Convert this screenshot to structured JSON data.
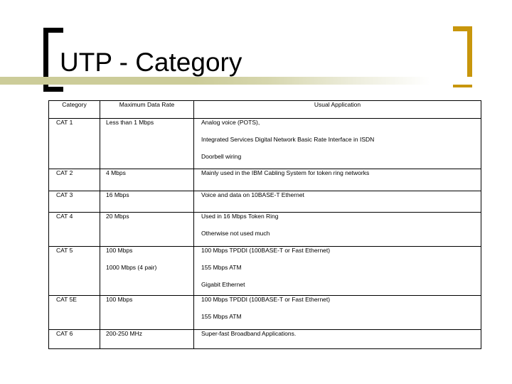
{
  "slide": {
    "title": "UTP - Category",
    "decor": {
      "bracket_left_color": "#000000",
      "bracket_right_color": "#C8960C",
      "band_color": "#CCCC99"
    }
  },
  "table": {
    "headers": [
      "Category",
      "Maximum Data Rate",
      "Usual Application"
    ],
    "rows": [
      {
        "category": "CAT 1",
        "rate": [
          "Less than 1 Mbps"
        ],
        "application": [
          "Analog voice (POTS),",
          "Integrated Services Digital Network Basic Rate Interface in ISDN",
          "Doorbell wiring"
        ]
      },
      {
        "category": "CAT 2",
        "rate": [
          "4 Mbps"
        ],
        "application": [
          "Mainly used in the IBM Cabling System for token ring networks"
        ]
      },
      {
        "category": "CAT 3",
        "rate": [
          "16 Mbps"
        ],
        "application": [
          "Voice and data on 10BASE-T Ethernet"
        ]
      },
      {
        "category": "CAT 4",
        "rate": [
          "20 Mbps"
        ],
        "application": [
          "Used in 16 Mbps Token Ring",
          "Otherwise not used much"
        ]
      },
      {
        "category": "CAT 5",
        "rate": [
          "100 Mbps",
          "1000 Mbps (4 pair)"
        ],
        "application": [
          "100 Mbps TPDDI (100BASE-T or Fast Ethernet)",
          "155 Mbps ATM",
          "Gigabit Ethernet"
        ]
      },
      {
        "category": "CAT 5E",
        "rate": [
          "100 Mbps"
        ],
        "application": [
          "100 Mbps TPDDI (100BASE-T or Fast Ethernet)",
          "155 Mbps ATM"
        ]
      },
      {
        "category": "CAT 6",
        "rate": [
          "200-250 MHz"
        ],
        "application": [
          "Super-fast Broadband Applications."
        ]
      }
    ]
  }
}
